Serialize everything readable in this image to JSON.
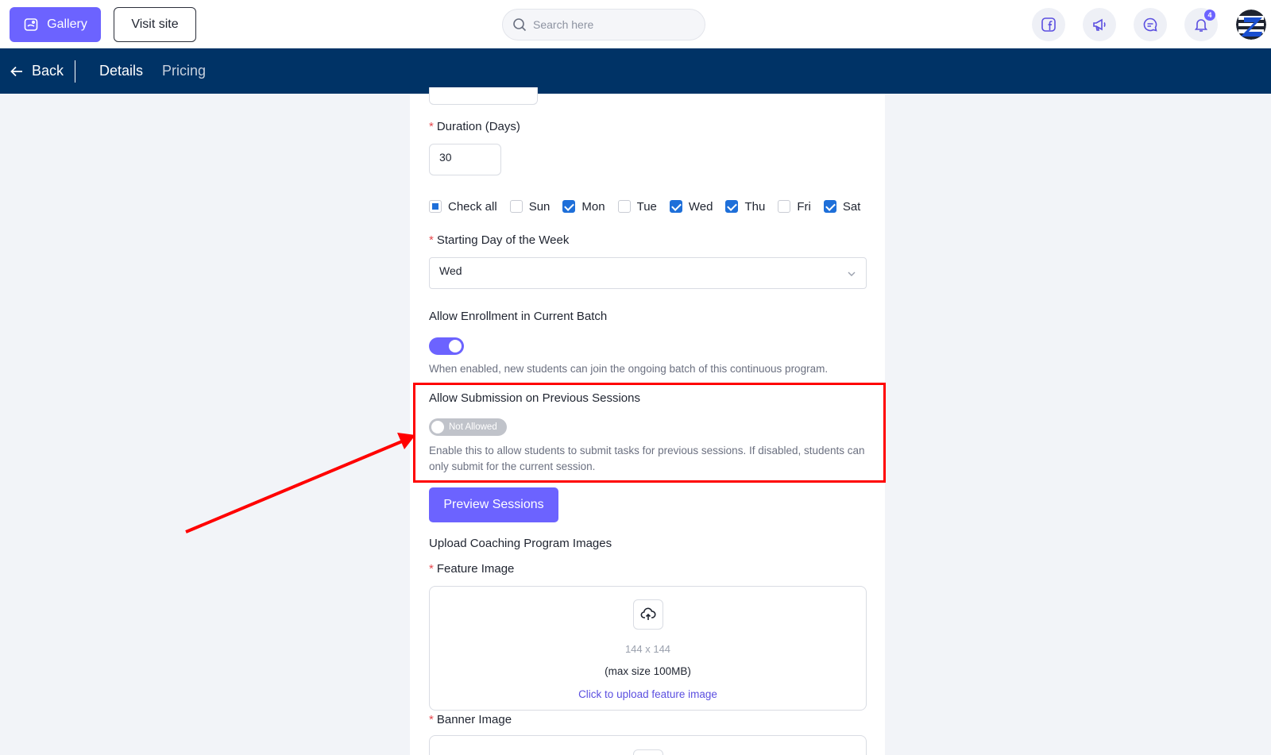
{
  "topbar": {
    "gallery_label": "Gallery",
    "visit_label": "Visit site",
    "search_placeholder": "Search here",
    "notification_count": "4"
  },
  "nav": {
    "back_label": "Back",
    "tabs": [
      {
        "label": "Details",
        "active": true
      },
      {
        "label": "Pricing",
        "active": false
      }
    ]
  },
  "form": {
    "duration_label": "Duration (Days)",
    "duration_value": "30",
    "days": {
      "check_all_label": "Check all",
      "items": [
        {
          "label": "Sun",
          "checked": false
        },
        {
          "label": "Mon",
          "checked": true
        },
        {
          "label": "Tue",
          "checked": false
        },
        {
          "label": "Wed",
          "checked": true
        },
        {
          "label": "Thu",
          "checked": true
        },
        {
          "label": "Fri",
          "checked": false
        },
        {
          "label": "Sat",
          "checked": true
        }
      ]
    },
    "starting_day_label": "Starting Day of the Week",
    "starting_day_value": "Wed",
    "enrollment_label": "Allow Enrollment in Current Batch",
    "enrollment_enabled": true,
    "enrollment_help": "When enabled, new students can join the ongoing batch of this continuous program.",
    "submission_label": "Allow Submission on Previous Sessions",
    "submission_toggle_text": "Not Allowed",
    "submission_enabled": false,
    "submission_help": "Enable this to allow students to submit tasks for previous sessions. If disabled, students can only submit for the current session.",
    "preview_button": "Preview Sessions",
    "upload_heading": "Upload Coaching Program Images",
    "feature_label": "Feature Image",
    "feature_size": "144 x 144",
    "feature_max": "(max size 100MB)",
    "feature_link": "Click to upload feature image",
    "banner_label": "Banner Image"
  },
  "colors": {
    "accent": "#6c63ff",
    "navbar": "#003366",
    "highlight": "#ff0000",
    "checkbox": "#1e6fd9"
  }
}
